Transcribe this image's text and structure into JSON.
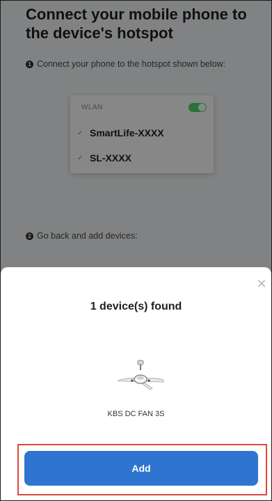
{
  "page": {
    "title": "Connect your mobile phone to the device's hotspot",
    "step1": "Connect your phone to the hotspot shown below:",
    "step2": "Go back and add devices:",
    "step1_num": "1",
    "step2_num": "2"
  },
  "wifi_card": {
    "wlan_label": "WLAN",
    "wlan_enabled": true,
    "networks": [
      {
        "check": "✓",
        "name": "SmartLife-XXXX"
      },
      {
        "check": "✓",
        "name": "SL-XXXX"
      }
    ]
  },
  "sheet": {
    "close_glyph": "✕",
    "found_text": "1 device(s) found",
    "device_icon": "ceiling-fan-icon",
    "device_name": "KBS DC FAN 3S",
    "add_label": "Add"
  },
  "colors": {
    "accent": "#2f75cf",
    "highlight": "#e0463b",
    "toggle_on": "#4cd964"
  }
}
